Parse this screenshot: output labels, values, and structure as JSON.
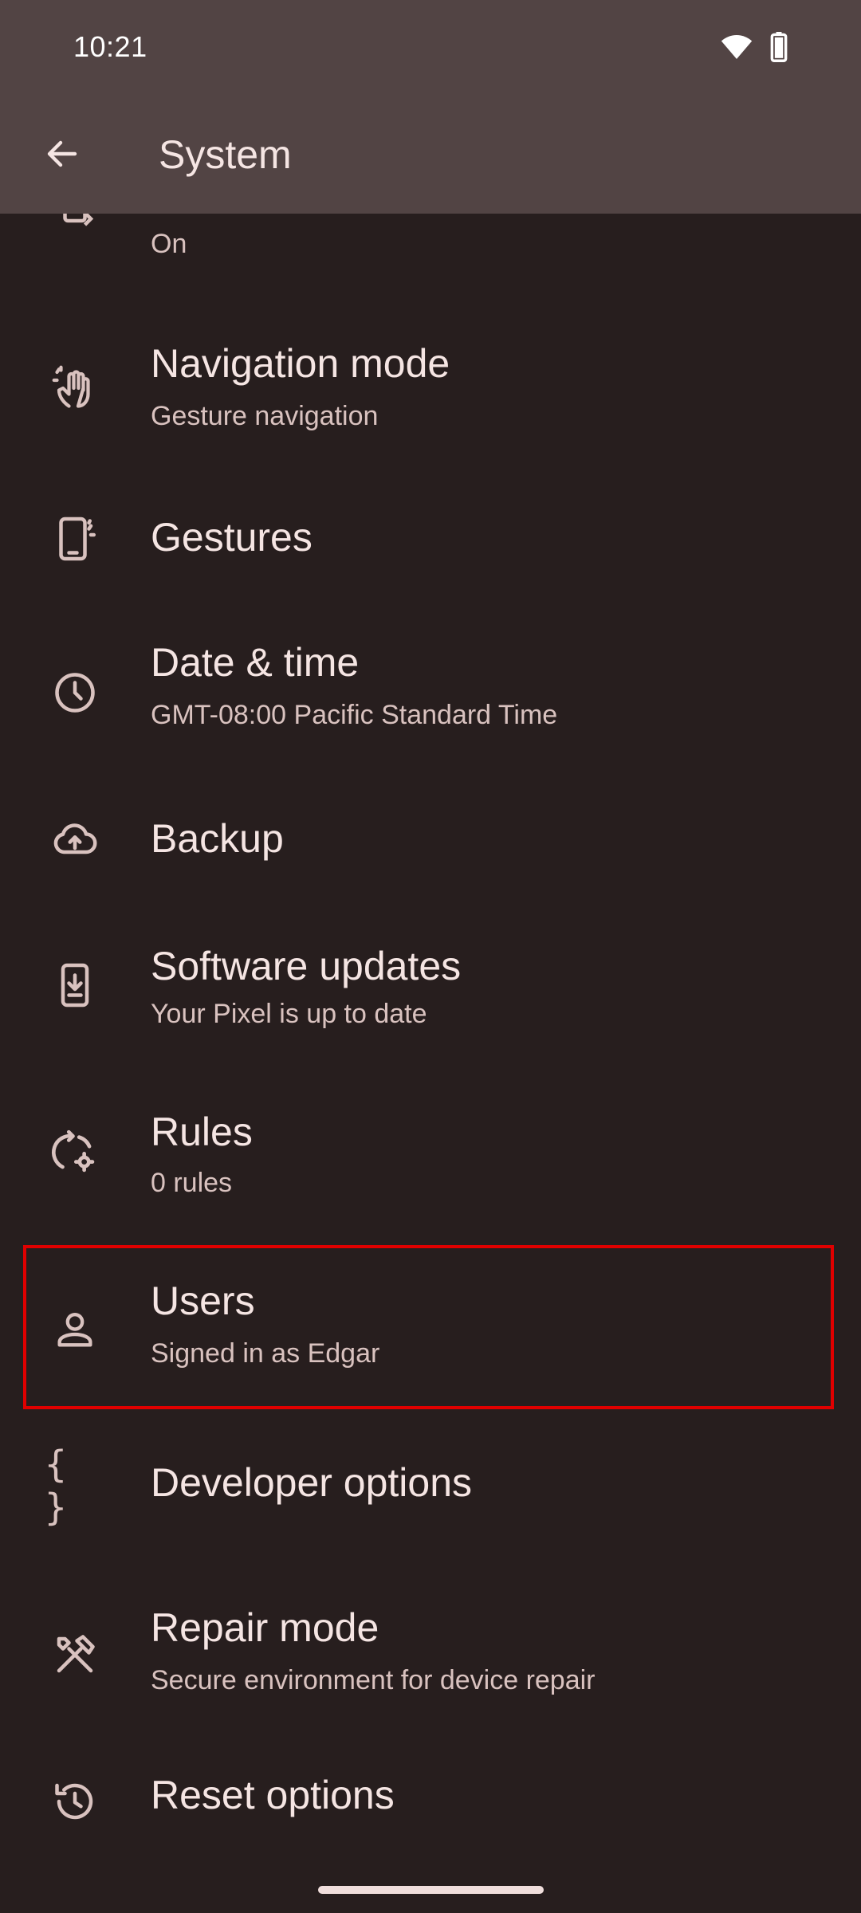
{
  "status_bar": {
    "time": "10:21",
    "icons": [
      "wifi-icon",
      "battery-icon"
    ]
  },
  "app_bar": {
    "title": "System",
    "back_icon": "arrow-back-icon"
  },
  "items": [
    {
      "icon": "screen-rotate-icon",
      "title": "",
      "summary": "On"
    },
    {
      "icon": "gesture-hand-icon",
      "title": "Navigation mode",
      "summary": "Gesture navigation"
    },
    {
      "icon": "phone-gesture-icon",
      "title": "Gestures",
      "summary": ""
    },
    {
      "icon": "clock-icon",
      "title": "Date & time",
      "summary": "GMT-08:00 Pacific Standard Time"
    },
    {
      "icon": "cloud-upload-icon",
      "title": "Backup",
      "summary": ""
    },
    {
      "icon": "system-update-icon",
      "title": "Software updates",
      "summary": "Your Pixel is up to date"
    },
    {
      "icon": "rules-sync-gear-icon",
      "title": "Rules",
      "summary": "0 rules"
    },
    {
      "icon": "person-icon",
      "title": "Users",
      "summary": "Signed in as Edgar"
    },
    {
      "icon": "code-braces-icon",
      "title": "Developer options",
      "summary": "",
      "icon_text": "{ }"
    },
    {
      "icon": "tools-icon",
      "title": "Repair mode",
      "summary": "Secure environment for device repair"
    },
    {
      "icon": "history-icon",
      "title": "Reset options",
      "summary": ""
    }
  ],
  "colors": {
    "background": "#271e1e",
    "app_bar": "#524444",
    "title_text": "#f5e5e3",
    "summary_text": "#d9c2bf",
    "highlight": "#e00000"
  }
}
